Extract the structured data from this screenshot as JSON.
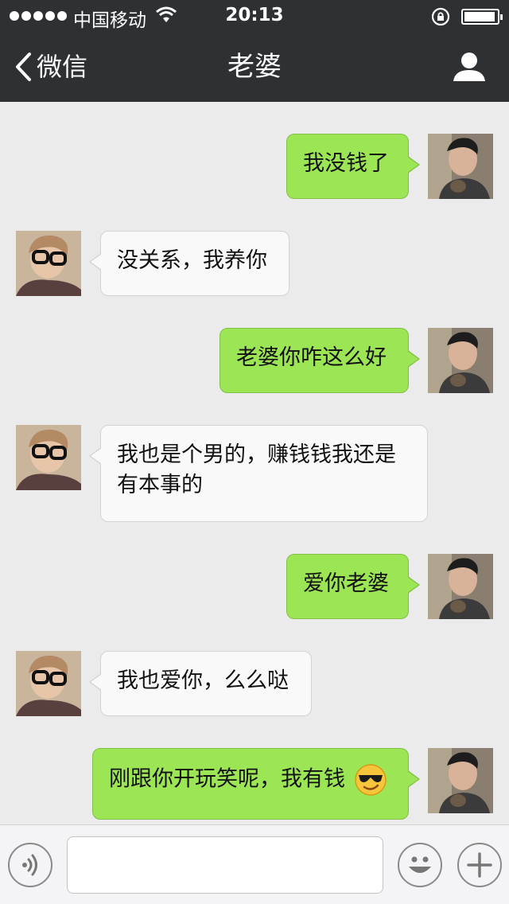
{
  "status_bar": {
    "carrier": "中国移动",
    "time": "20:13"
  },
  "nav": {
    "back_label": "微信",
    "title": "老婆"
  },
  "messages": [
    {
      "sender": "me",
      "text": "我没钱了"
    },
    {
      "sender": "other",
      "text": "没关系，我养你"
    },
    {
      "sender": "me",
      "text": "老婆你咋这么好"
    },
    {
      "sender": "other",
      "text": "我也是个男的，赚钱钱我还是有本事的"
    },
    {
      "sender": "me",
      "text": "爱你老婆"
    },
    {
      "sender": "other",
      "text": "我也爱你，么么哒"
    },
    {
      "sender": "me",
      "text": "刚跟你开玩笑呢，我有钱",
      "emoji": "sunglasses-smile-emoji"
    }
  ],
  "input_bar": {
    "voice_icon": "voice-icon",
    "emoji_icon": "smiley-icon",
    "more_icon": "plus-icon",
    "message_value": ""
  },
  "colors": {
    "nav_bg": "#2e3134",
    "chat_bg": "#ebebeb",
    "outgoing_bubble": "#9ce554",
    "incoming_bubble": "#f9f9f9"
  }
}
